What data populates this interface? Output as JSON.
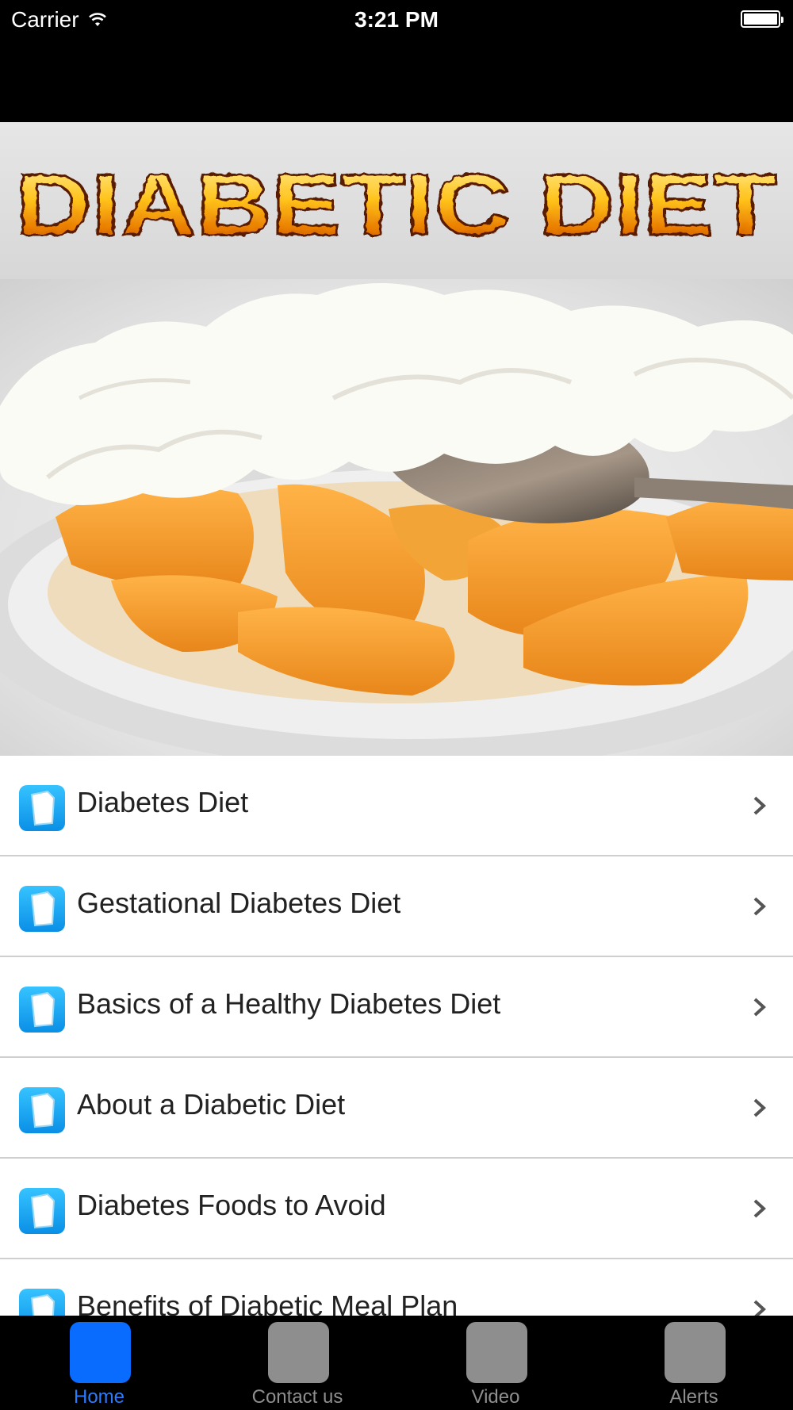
{
  "status_bar": {
    "carrier": "Carrier",
    "time": "3:21 PM"
  },
  "banner": {
    "logo_text": "DIABETIC DIET"
  },
  "hero": {
    "image": "bowl-of-peaches-with-whipped-cream"
  },
  "list_items": [
    {
      "label": "Diabetes Diet"
    },
    {
      "label": "Gestational Diabetes Diet"
    },
    {
      "label": "Basics of a Healthy Diabetes Diet"
    },
    {
      "label": "About a Diabetic Diet"
    },
    {
      "label": "Diabetes Foods to Avoid"
    },
    {
      "label": "Benefits of Diabetic Meal Plan"
    }
  ],
  "tabs": [
    {
      "label": "Home",
      "active": true
    },
    {
      "label": "Contact us",
      "active": false
    },
    {
      "label": "Video",
      "active": false
    },
    {
      "label": "Alerts",
      "active": false
    }
  ],
  "colors": {
    "accent": "#0a6cff",
    "tab_inactive": "#8e8e8e",
    "icon_blue": "#1aa7f2"
  }
}
